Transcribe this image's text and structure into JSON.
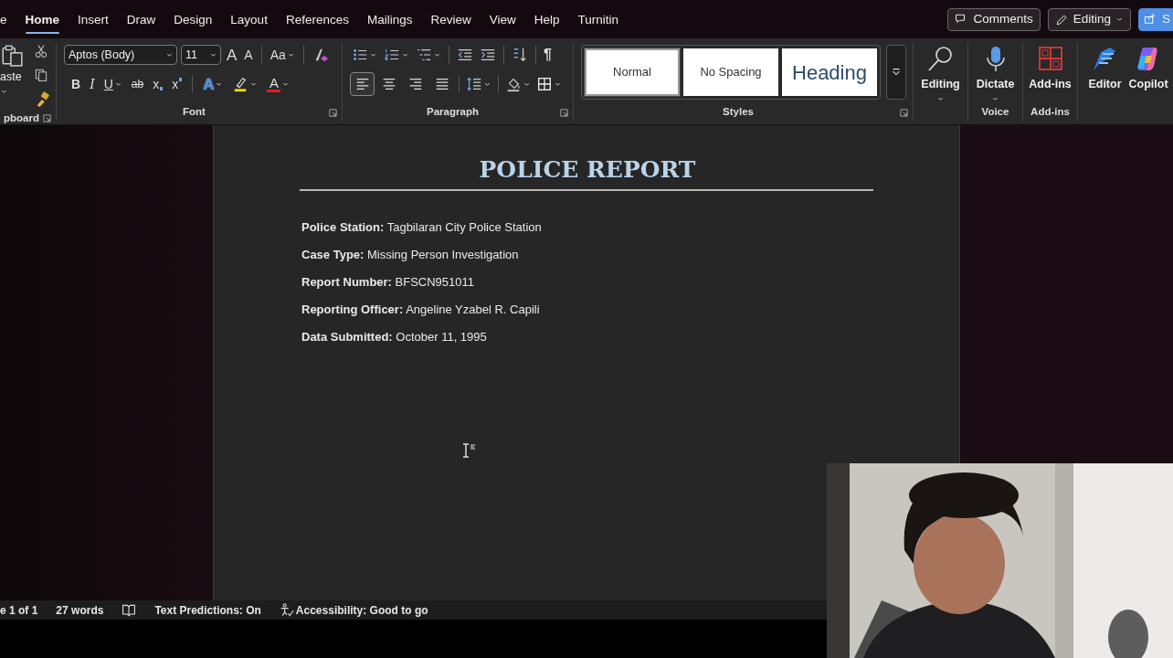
{
  "tabs": [
    {
      "label": "e",
      "selected": false
    },
    {
      "label": "Home",
      "selected": true
    },
    {
      "label": "Insert",
      "selected": false
    },
    {
      "label": "Draw",
      "selected": false
    },
    {
      "label": "Design",
      "selected": false
    },
    {
      "label": "Layout",
      "selected": false
    },
    {
      "label": "References",
      "selected": false
    },
    {
      "label": "Mailings",
      "selected": false
    },
    {
      "label": "Review",
      "selected": false
    },
    {
      "label": "View",
      "selected": false
    },
    {
      "label": "Help",
      "selected": false
    },
    {
      "label": "Turnitin",
      "selected": false
    }
  ],
  "header_buttons": [
    {
      "kind": "comments",
      "label": "Comments"
    },
    {
      "kind": "editing",
      "label": "Editing"
    },
    {
      "kind": "share",
      "label": "S"
    }
  ],
  "ribbon": {
    "clipboard": {
      "paste_label": "aste",
      "group_label": "pboard"
    },
    "font": {
      "group_label": "Font",
      "font_name": "Aptos (Body)",
      "font_size": "11",
      "grow_glyph": "A",
      "shrink_glyph": "A",
      "case_glyph": "Aa",
      "format_buttons": [
        {
          "kind": "bold",
          "glyph": "B"
        },
        {
          "kind": "italic",
          "glyph": "I"
        },
        {
          "kind": "underline",
          "glyph": "U"
        },
        {
          "kind": "strike",
          "glyph": "ab"
        },
        {
          "kind": "subscript",
          "glyph": "x"
        },
        {
          "kind": "superscript",
          "glyph": "x"
        }
      ],
      "effects_glyph": "A",
      "color_glyph": "A"
    },
    "paragraph": {
      "group_label": "Paragraph",
      "pilcrow": "¶",
      "alignments": [
        {
          "kind": "left",
          "selected": true
        },
        {
          "kind": "center",
          "selected": false
        },
        {
          "kind": "right",
          "selected": false
        },
        {
          "kind": "justify",
          "selected": false
        }
      ]
    },
    "styles": {
      "group_label": "Styles",
      "items": [
        {
          "kind": "plain",
          "label": "Normal",
          "selected": true
        },
        {
          "kind": "plain",
          "label": "No Spacing",
          "selected": false
        },
        {
          "kind": "heading",
          "label": "Heading",
          "selected": false
        }
      ]
    },
    "command_groups": [
      {
        "buttons": [
          {
            "kind": "find",
            "label": "Editing",
            "dropdown": true
          }
        ]
      },
      {
        "label": "Voice",
        "buttons": [
          {
            "kind": "mic",
            "label": "Dictate",
            "dropdown": true
          }
        ]
      },
      {
        "label": "Add-ins",
        "buttons": [
          {
            "kind": "addins",
            "label": "Add-ins",
            "dropdown": false
          }
        ]
      },
      {
        "buttons": [
          {
            "kind": "editor",
            "label": "Editor",
            "dropdown": false
          },
          {
            "kind": "copilot",
            "label": "Copilot",
            "dropdown": false
          }
        ]
      }
    ]
  },
  "document": {
    "title": "POLICE REPORT",
    "fields": [
      "**Police Station:** Tagbilaran City Police Station",
      "**Case Type:** Missing Person Investigation",
      "**Report Number:** BFSCN951011",
      "**Reporting Officer:** Angeline Yzabel R. Capili",
      "**Data Submitted:** October 11, 1995"
    ]
  },
  "status_bar": {
    "page": "e 1 of 1",
    "words": "27 words",
    "predictions": "Text Predictions: On",
    "accessibility": "Accessibility: Good to go"
  }
}
